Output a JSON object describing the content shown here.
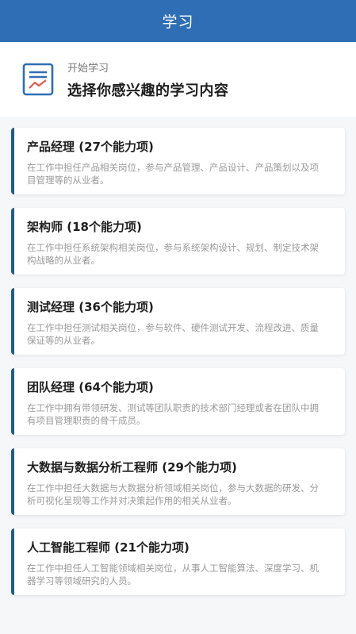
{
  "header": {
    "title": "学习"
  },
  "hero": {
    "icon": "chart-document-icon",
    "kicker": "开始学习",
    "title": "选择你感兴趣的学习内容"
  },
  "colors": {
    "header_bg": "#2f6eb5",
    "card_accent": "#1f5e84",
    "icon_blue": "#2f6eb5",
    "icon_red": "#e05a4f"
  },
  "courses": [
    {
      "title": "产品经理 (27个能力项)",
      "desc": "在工作中担任产品相关岗位，参与产品管理、产品设计、产品策划以及项目管理等的从业者。"
    },
    {
      "title": "架构师 (18个能力项)",
      "desc": "在工作中担任系统架构相关岗位，参与系统架构设计、规划、制定技术架构战略的从业者。"
    },
    {
      "title": "测试经理 (36个能力项)",
      "desc": "在工作中担任测试相关岗位，参与软件、硬件测试开发、流程改进、质量保证等的从业者。"
    },
    {
      "title": "团队经理 (64个能力项)",
      "desc": "在工作中拥有带领研发、测试等团队职责的技术部门经理或者在团队中拥有项目管理职责的骨干成员。"
    },
    {
      "title": "大数据与数据分析工程师 (29个能力项)",
      "desc": "在工作中担任大数据与大数据分析领域相关岗位，参与大数据的研发、分析可视化呈现等工作并对决策起作用的相关从业者。"
    },
    {
      "title": "人工智能工程师 (21个能力项)",
      "desc": "在工作中担任人工智能领域相关岗位，从事人工智能算法、深度学习、机器学习等领域研究的人员。"
    }
  ]
}
